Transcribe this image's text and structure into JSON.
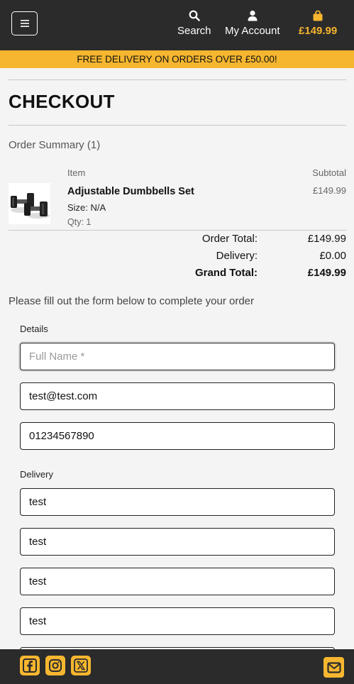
{
  "header": {
    "search_label": "Search",
    "account_label": "My Account",
    "bag_total": "£149.99",
    "accent_color": "#f6b62f"
  },
  "promo": {
    "text": "FREE DELIVERY ON ORDERS OVER £50.00!"
  },
  "page": {
    "title": "CHECKOUT",
    "summary_heading": "Order Summary (1)"
  },
  "summary": {
    "col_item": "Item",
    "col_subtotal": "Subtotal",
    "items": [
      {
        "name": "Adjustable Dumbbells Set",
        "size": "Size: N/A",
        "qty": "Qty: 1",
        "price": "£149.99"
      }
    ],
    "order_total_label": "Order Total:",
    "order_total_value": "£149.99",
    "delivery_label": "Delivery:",
    "delivery_value": "£0.00",
    "grand_total_label": "Grand Total:",
    "grand_total_value": "£149.99"
  },
  "form": {
    "instructions": "Please fill out the form below to complete your order",
    "details_legend": "Details",
    "full_name_placeholder": "Full Name *",
    "full_name_value": "",
    "email_value": "test@test.com",
    "phone_value": "01234567890",
    "delivery_legend": "Delivery",
    "delivery_fields": [
      "test",
      "test",
      "test",
      "test",
      ""
    ]
  },
  "footer": {
    "icons": [
      "facebook-icon",
      "instagram-icon",
      "x-icon",
      "mail-icon"
    ]
  }
}
